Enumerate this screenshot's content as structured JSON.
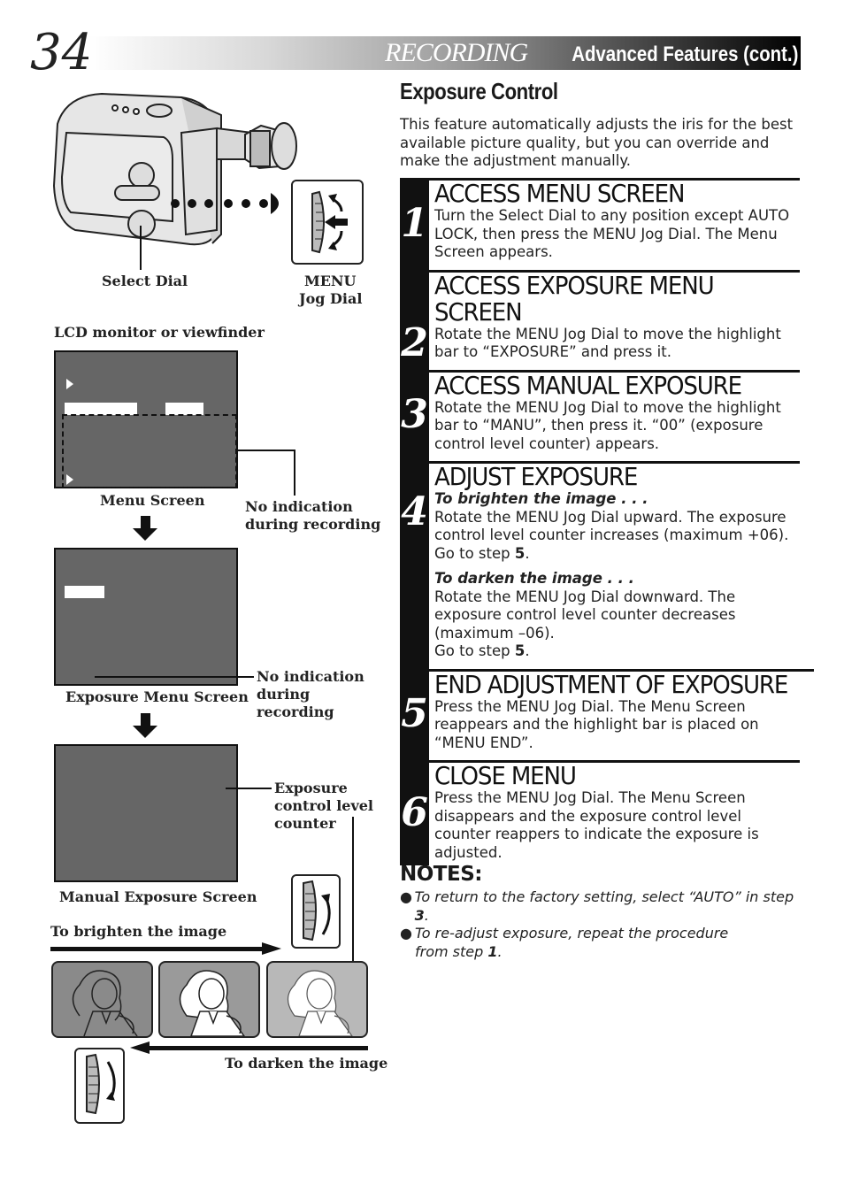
{
  "header": {
    "page_number": "34",
    "section": "RECORDING",
    "subtitle": "Advanced Features (cont.)"
  },
  "main": {
    "title": "Exposure Control",
    "intro": "This feature automatically adjusts the iris for the best available picture quality, but you can override and make the adjustment manually.",
    "steps": [
      {
        "number": "1",
        "heading": "ACCESS MENU SCREEN",
        "text": "Turn the Select Dial to any position except AUTO LOCK, then press the MENU Jog Dial. The Menu Screen appears."
      },
      {
        "number": "2",
        "heading": "ACCESS EXPOSURE MENU SCREEN",
        "text": "Rotate the MENU Jog Dial to move the highlight bar to “EXPOSURE” and press it."
      },
      {
        "number": "3",
        "heading": "ACCESS MANUAL EXPOSURE",
        "text": "Rotate the MENU Jog Dial to move the highlight bar to “MANU”, then press it. “00” (exposure control level counter) appears."
      },
      {
        "number": "4",
        "heading": "ADJUST EXPOSURE",
        "brighten_label": "To brighten the image . . .",
        "brighten_text": "Rotate the MENU Jog Dial upward. The exposure control level counter increases (maximum +06).",
        "brighten_goto": "Go to step ",
        "brighten_goto_step": "5",
        "darken_label": "To darken the image . . .",
        "darken_text": "Rotate the MENU Jog Dial downward. The exposure control level counter decreases (maximum –06).",
        "darken_goto": "Go to step ",
        "darken_goto_step": "5"
      },
      {
        "number": "5",
        "heading": "END ADJUSTMENT OF EXPOSURE",
        "text": "Press the MENU Jog Dial. The Menu Screen reappears and the highlight bar is placed on “MENU END”."
      },
      {
        "number": "6",
        "heading": "CLOSE MENU",
        "text": "Press the MENU Jog Dial. The Menu Screen disappears and the exposure control level counter reappers to indicate the exposure is adjusted."
      }
    ],
    "notes_title": "NOTES:",
    "notes": [
      {
        "text": "To return to the factory setting, select “AUTO” in step ",
        "bold": "3",
        "end": "."
      },
      {
        "text": "To re-adjust exposure, repeat the procedure from step ",
        "bold": "1",
        "end": "."
      }
    ]
  },
  "illustration": {
    "select_dial_label": "Select Dial",
    "menu_label": "MENU",
    "jog_dial_label": "Jog Dial",
    "lcd_label": "LCD monitor or viewfinder",
    "menu_screen_label": "Menu Screen",
    "no_indication_1": [
      "No indication",
      "during recording"
    ],
    "exposure_menu_screen_label": "Exposure Menu Screen",
    "no_indication_2": [
      "No indication",
      "during",
      "recording"
    ],
    "counter_label": [
      "Exposure",
      "control level",
      "counter"
    ],
    "manual_exposure_screen_label": "Manual Exposure Screen",
    "brighten_label": "To brighten the image",
    "darken_label": "To darken the image"
  },
  "colors": {
    "screen_gray": "#666666",
    "thumb_dark": "#8a8a8a",
    "thumb_mid": "#9a9a9a",
    "thumb_light": "#b8b8b8"
  }
}
